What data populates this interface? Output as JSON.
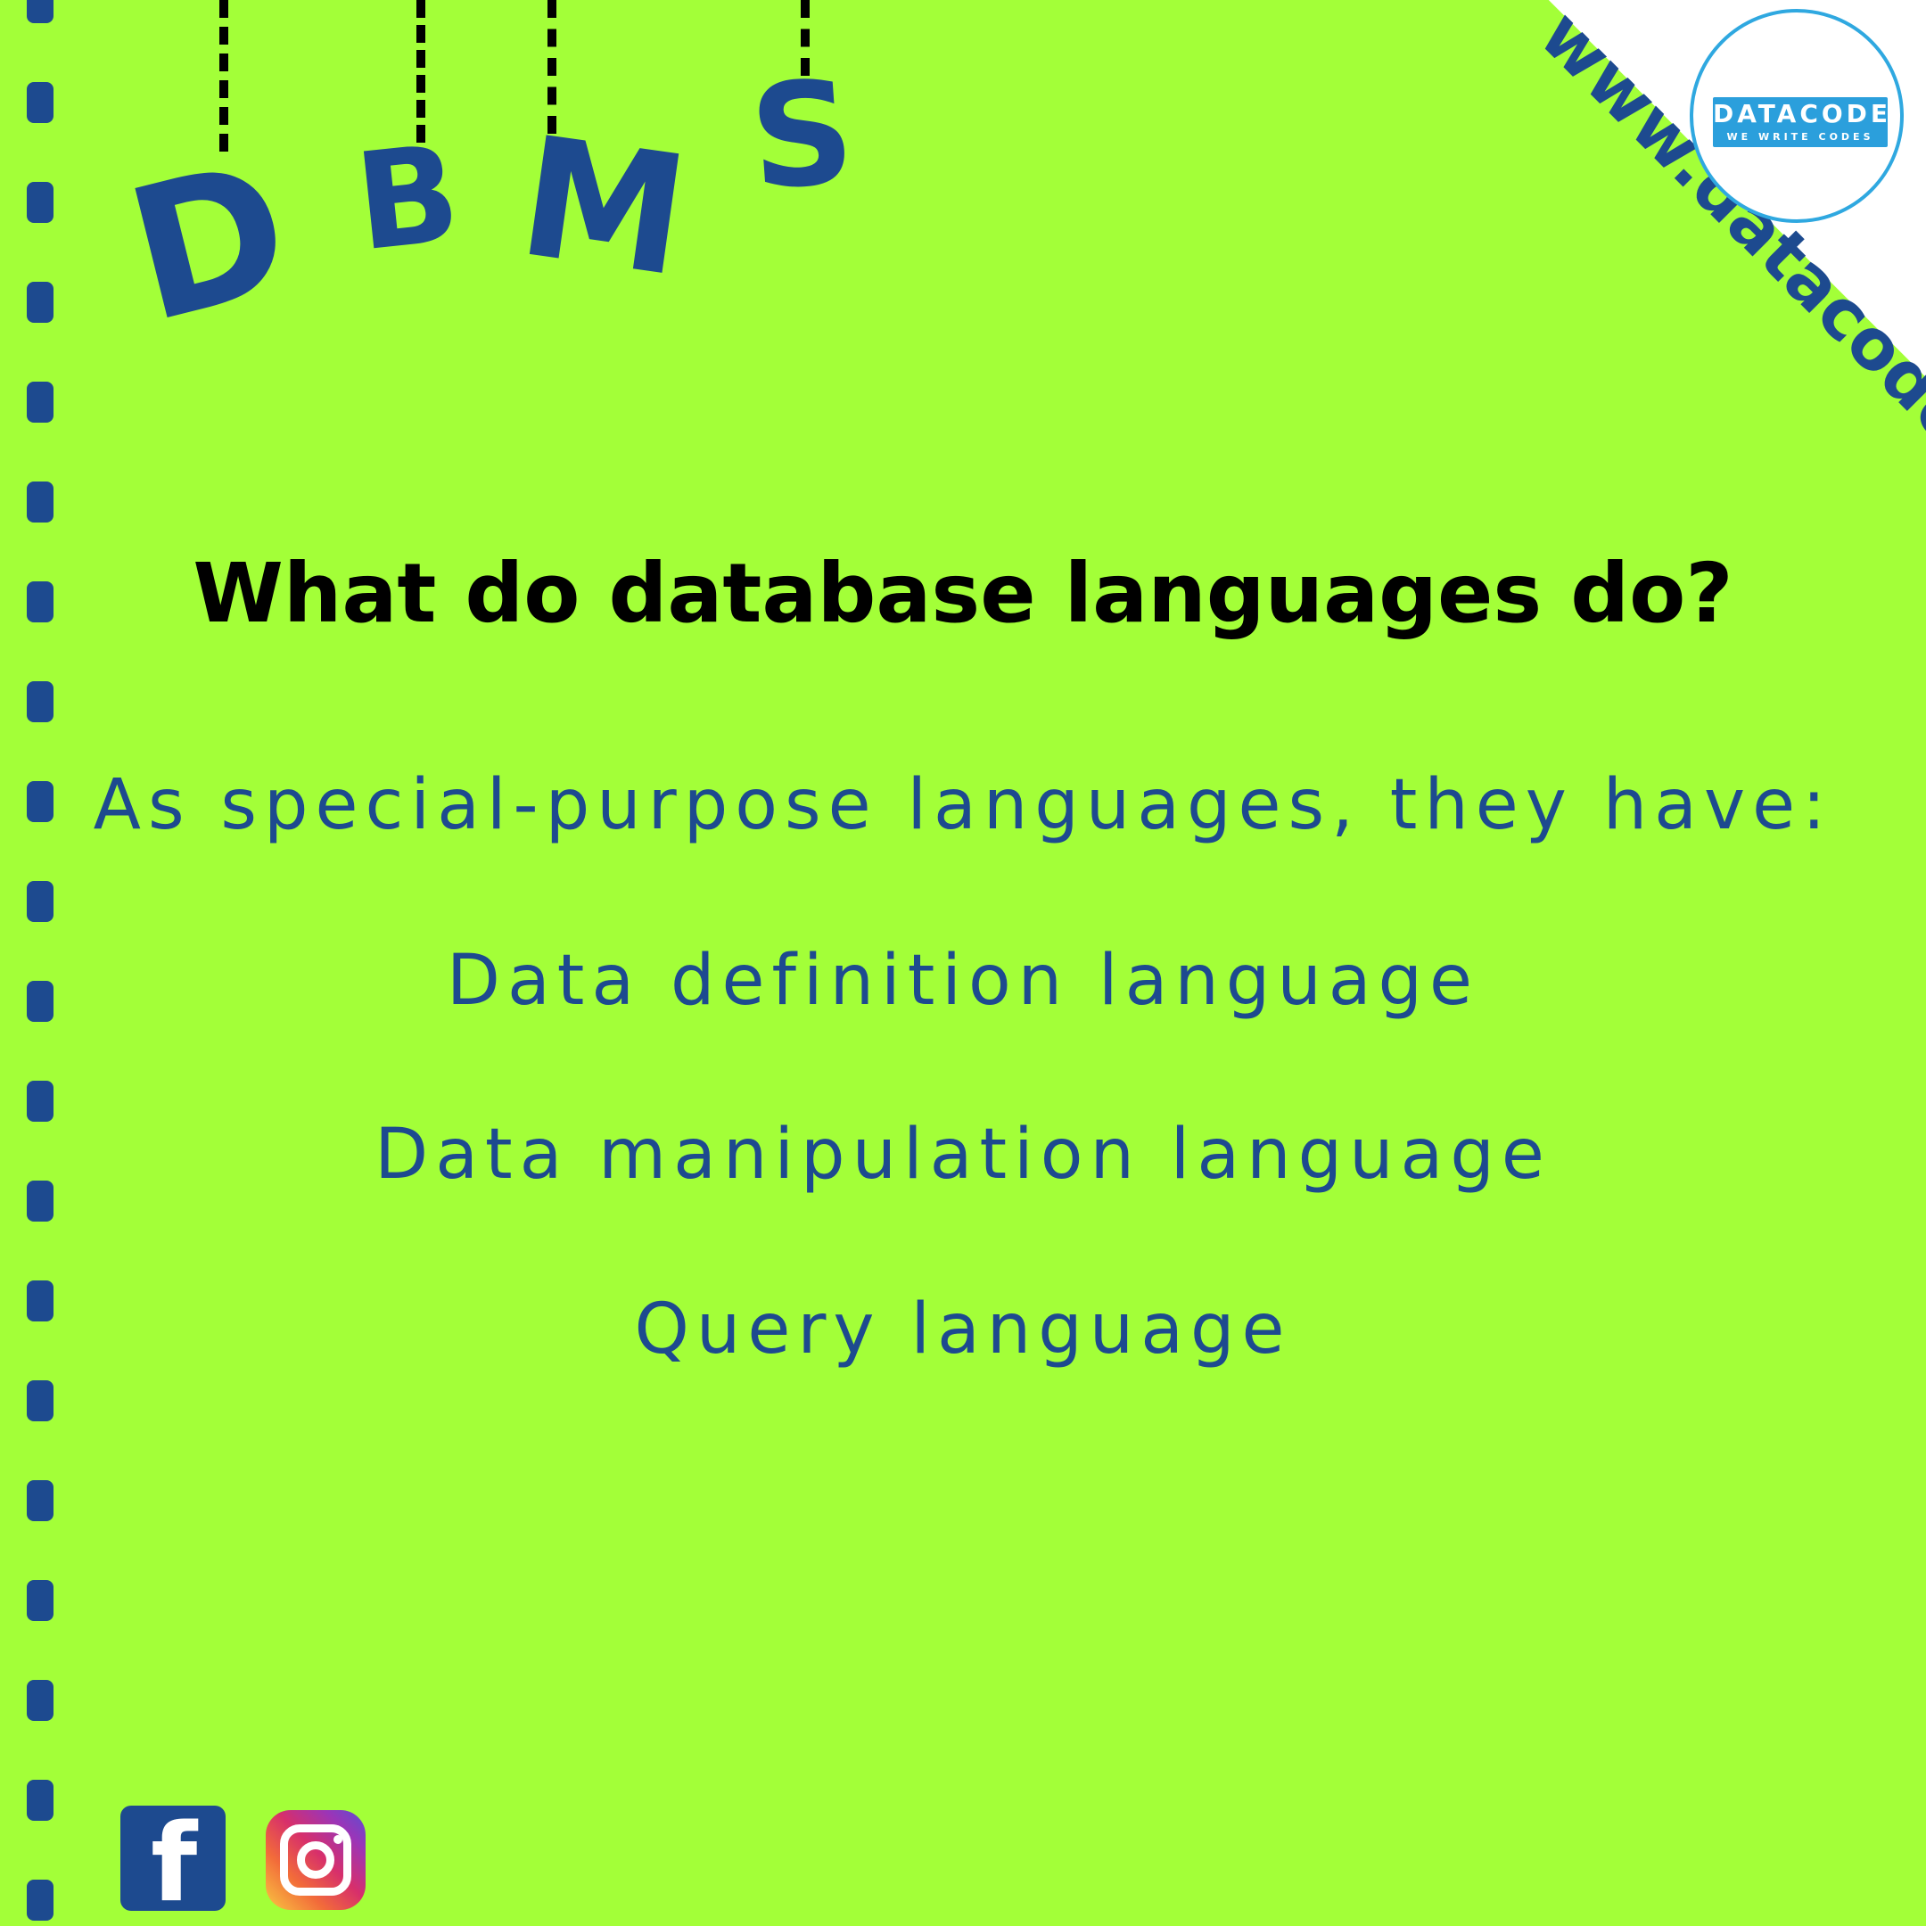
{
  "title": {
    "letters": [
      "D",
      "B",
      "M",
      "S"
    ]
  },
  "brand": {
    "url": "www.datacode.in",
    "logo_name": "DATACODE",
    "logo_tagline": "WE WRITE CODES"
  },
  "content": {
    "heading": "What do database languages do?",
    "intro": "As special-purpose languages, they have:",
    "items": [
      "Data definition language",
      "Data manipulation language",
      "Query language"
    ]
  },
  "social": {
    "icons": [
      "facebook-icon",
      "instagram-icon"
    ]
  },
  "colors": {
    "background": "#a3ff38",
    "accent": "#1d4a8f",
    "logo_blue": "#2b9fdc"
  }
}
